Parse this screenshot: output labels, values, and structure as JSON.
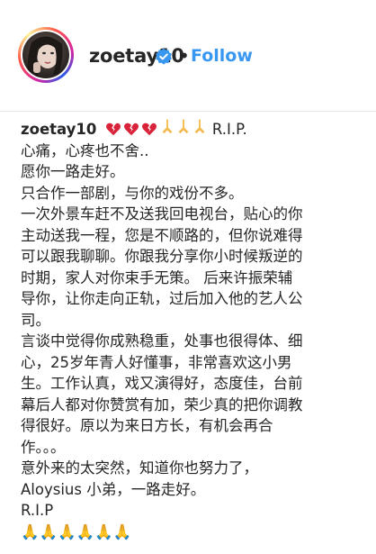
{
  "header": {
    "username": "zoetay10",
    "separator": "•",
    "follow_label": "Follow",
    "accent_color": "#3897f0"
  },
  "caption": {
    "username": "zoetay10",
    "title_emojis": "💔💔💔🙏🙏🙏",
    "title_text": "R.I.P.",
    "lines": [
      "心痛，心疼也不舍..",
      "愿你一路走好。",
      "只合作一部剧，与你的戏份不多。",
      "一次外景车赶不及送我回电视台，贴心的你",
      "主动送我一程，您是不顺路的，但你说难得",
      "可以跟我聊聊。你跟我分享你小时候叛逆的",
      "时期，家人对你束手无策。 后来许振荣辅",
      "导你，让你走向正轨，过后加入他的艺人公",
      "司。",
      "言谈中觉得你成熟稳重，处事也很得体、细",
      "心，25岁年青人好懂事，非常喜欢这小男",
      "生。工作认真，戏又演得好，态度佳，台前",
      "幕后人都对你赞赏有加，荣少真的把你调教",
      "得很好。原以为来日方长，有机会再合",
      "作。。。",
      "意外来的太突然，知道你也努力了，",
      "Aloysius 小弟，一路走好。",
      "R.I.P",
      "🙏🙏🙏🙏🙏🙏"
    ]
  }
}
